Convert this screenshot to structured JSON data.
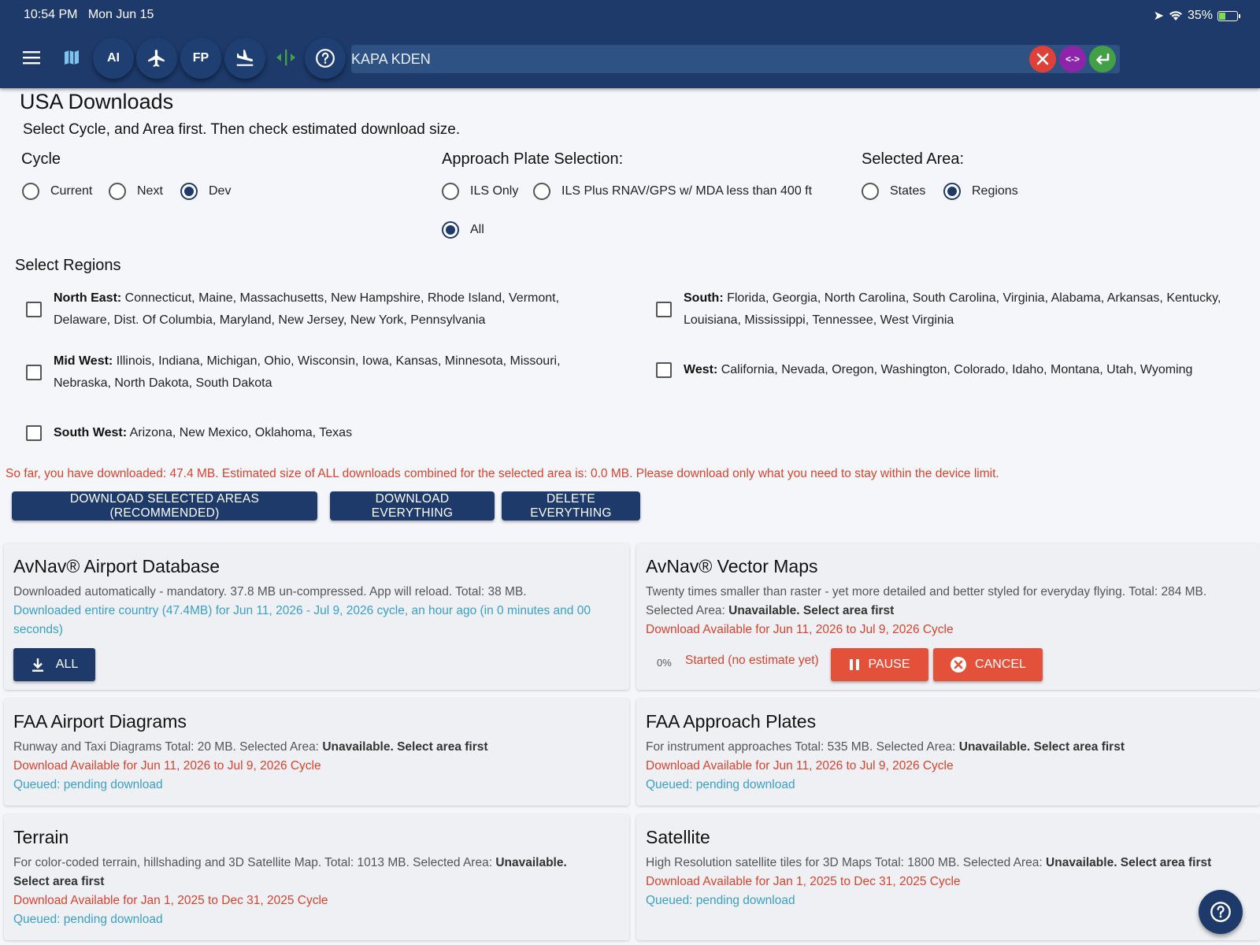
{
  "status": {
    "time": "10:54 PM",
    "date": "Mon Jun 15",
    "battery": "35%"
  },
  "toolbar": {
    "ai_label": "AI",
    "fp_label": "FP",
    "search_value": "KAPA KDEN",
    "swap_label": "<->"
  },
  "page": {
    "title": "USA Downloads",
    "subtitle": "Select Cycle, and Area first. Then check estimated download size."
  },
  "cycle": {
    "label": "Cycle",
    "options": [
      "Current",
      "Next",
      "Dev"
    ],
    "selected": "Dev"
  },
  "approach": {
    "label": "Approach Plate Selection:",
    "options": [
      "ILS Only",
      "ILS Plus RNAV/GPS w/ MDA less than 400 ft",
      "All"
    ],
    "selected": "All"
  },
  "area": {
    "label": "Selected Area:",
    "options": [
      "States",
      "Regions"
    ],
    "selected": "Regions"
  },
  "regions": {
    "label": "Select Regions",
    "items": [
      {
        "name": "North East:",
        "states_1": " Connecticut, Maine, Massachusetts, New Hampshire, Rhode Island, Vermont,",
        "states_2": "Delaware, Dist. Of Columbia, Maryland, New Jersey, New York, Pennsylvania"
      },
      {
        "name": "South:",
        "states_1": " Florida, Georgia, North Carolina, South Carolina, Virginia, Alabama, Arkansas, Kentucky,",
        "states_2": "Louisiana, Mississippi, Tennessee, West Virginia"
      },
      {
        "name": "Mid West:",
        "states_1": " Illinois, Indiana, Michigan, Ohio, Wisconsin, Iowa, Kansas, Minnesota, Missouri,",
        "states_2": "Nebraska, North Dakota, South Dakota"
      },
      {
        "name": "West:",
        "states_1": " California, Nevada, Oregon, Washington, Colorado, Idaho, Montana, Utah, Wyoming"
      },
      {
        "name": "South West:",
        "states_1": " Arizona, New Mexico, Oklahoma, Texas"
      }
    ]
  },
  "warning": "So far, you have downloaded: 47.4 MB. Estimated size of ALL downloads combined for the selected area is: 0.0 MB. Please download only what you need to stay within the device limit.",
  "actions": {
    "download_selected": "DOWNLOAD SELECTED AREAS (RECOMMENDED)",
    "download_everything": "DOWNLOAD EVERYTHING",
    "delete_everything": "DELETE EVERYTHING"
  },
  "cards": {
    "airport_db": {
      "title": "AvNav® Airport Database",
      "desc": "Downloaded automatically - mandatory. 37.8 MB un-compressed. App will reload. Total: 38 MB.",
      "status_1": "Downloaded entire country (47.4MB) for Jun 11, 2026 - Jul 9, 2026 cycle, an hour ago (in 0 minutes and 00",
      "status_2": "seconds)",
      "button": "ALL"
    },
    "vector_maps": {
      "title": "AvNav® Vector Maps",
      "desc": "Twenty times smaller than raster - yet more detailed and better styled for everyday flying. Total: 284 MB.",
      "area_prefix": "Selected Area: ",
      "area_value": "Unavailable. Select area first",
      "available": "Download Available for Jun 11, 2026 to Jul 9, 2026 Cycle",
      "progress": "0%",
      "progress_status": "Started (no estimate yet)",
      "pause": "PAUSE",
      "cancel": "CANCEL"
    },
    "airport_diagrams": {
      "title": "FAA Airport Diagrams",
      "desc_prefix": "Runway and Taxi Diagrams Total: 20 MB. Selected Area: ",
      "desc_bold": "Unavailable. Select area first",
      "available": "Download Available for Jun 11, 2026 to Jul 9, 2026 Cycle",
      "queued": "Queued: pending download"
    },
    "approach_plates": {
      "title": "FAA Approach Plates",
      "desc_prefix": "For instrument approaches Total: 535 MB. Selected Area: ",
      "desc_bold": "Unavailable. Select area first",
      "available": "Download Available for Jun 11, 2026 to Jul 9, 2026 Cycle",
      "queued": "Queued: pending download"
    },
    "terrain": {
      "title": "Terrain",
      "desc_prefix": "For color-coded terrain, hillshading and 3D Satellite Map. Total: 1013 MB. Selected Area: ",
      "desc_bold_1": "Unavailable.",
      "desc_bold_2": "Select area first",
      "available": "Download Available for Jan 1, 2025 to Dec 31, 2025 Cycle",
      "queued": "Queued: pending download"
    },
    "satellite": {
      "title": "Satellite",
      "desc_prefix": "High Resolution satellite tiles for 3D Maps Total: 1800 MB. Selected Area: ",
      "desc_bold": "Unavailable. Select area first",
      "available": "Download Available for Jan 1, 2025 to Dec 31, 2025 Cycle",
      "queued": "Queued: pending download"
    }
  },
  "colors": {
    "navy": "#1d3a6b",
    "red": "#d8432f",
    "teal": "#3aa0c8",
    "accent_green": "#43a047",
    "accent_purple": "#8e24aa"
  }
}
